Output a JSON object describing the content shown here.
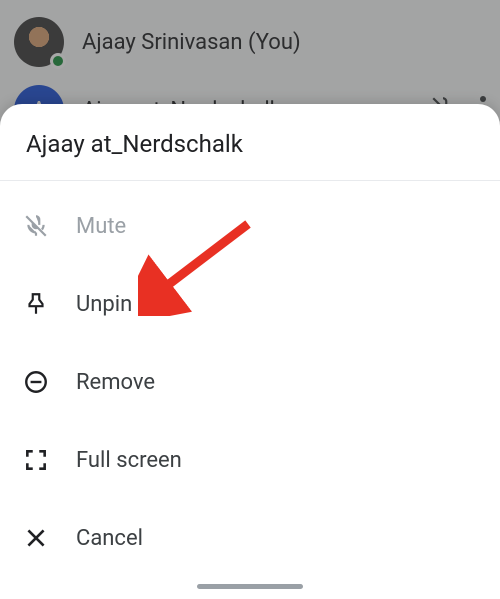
{
  "background": {
    "participants": [
      {
        "name": "Ajaay Srinivasan (You)",
        "avatar_kind": "photo",
        "presence": true
      },
      {
        "name": "Ajaay at_Nerdschalk",
        "avatar_kind": "letter",
        "avatar_letter": "A",
        "muted_icon": true
      }
    ]
  },
  "sheet": {
    "title": "Ajaay at_Nerdschalk",
    "items": [
      {
        "icon": "mic-off-icon",
        "label": "Mute",
        "disabled": true
      },
      {
        "icon": "pin-icon",
        "label": "Unpin",
        "disabled": false
      },
      {
        "icon": "remove-icon",
        "label": "Remove",
        "disabled": false
      },
      {
        "icon": "fullscreen-icon",
        "label": "Full screen",
        "disabled": false
      },
      {
        "icon": "cancel-icon",
        "label": "Cancel",
        "disabled": false
      }
    ]
  },
  "annotation": {
    "arrow_color": "#e83023",
    "points_to": "unpin"
  }
}
